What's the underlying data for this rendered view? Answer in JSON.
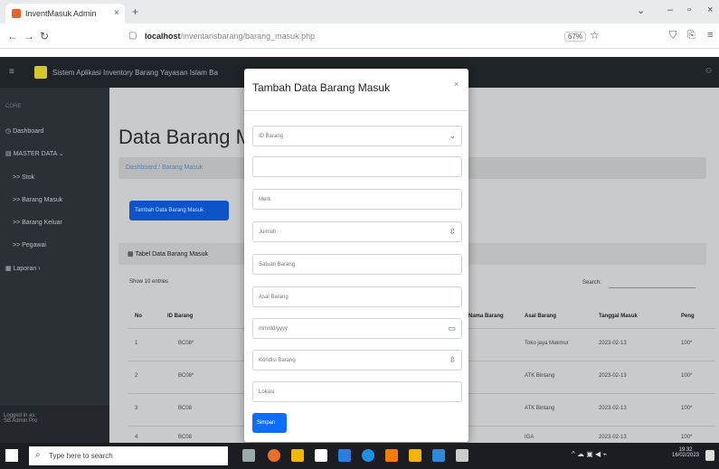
{
  "browser": {
    "tab_title": "InventMasuk Admin",
    "url_host": "localhost",
    "url_path": "/inventarisbarang/barang_masuk.php",
    "zoom": "67%"
  },
  "app": {
    "brand": "Sistem Aplikasi Inventory Barang Yayasan Islam Ba",
    "sidebar": {
      "core_heading": "CORE",
      "dashboard": "Dashboard",
      "master_heading": "MASTER DATA",
      "items": [
        ">> Stok",
        ">> Barang Masuk",
        ">> Barang Keluar",
        ">> Pegawai"
      ],
      "laporan": "Laporan",
      "footer_line1": "Logged in as:",
      "footer_line2": "SB Admin Pro"
    },
    "page_title": "Data Barang Ma",
    "breadcrumb": "Dashboard / Barang Masuk",
    "add_button": "Tambah Data Barang Masuk",
    "card_title": "Tabel Data Barang Masuk",
    "show_entries": "Show 10 entries",
    "search_label": "Search:",
    "table": {
      "headers": [
        "No",
        "ID Barang",
        "Nama Barang",
        "Asal Barang",
        "Tanggal Masuk",
        "Peng"
      ],
      "rows": [
        [
          "1",
          "BC08*",
          "Toko jaya Makmur",
          "2023-02-13",
          "100*"
        ],
        [
          "2",
          "BC08*",
          "ATK Bintang",
          "2023-02-13",
          "100*"
        ],
        [
          "3",
          "BC08",
          "ATK Bintang",
          "2023-02-13",
          "100*"
        ],
        [
          "4",
          "BC08",
          "IGA",
          "2023-02-13",
          "100*"
        ]
      ]
    }
  },
  "modal": {
    "title": "Tambah Data Barang Masuk",
    "close": "×",
    "fields": {
      "id_barang": "ID Barang",
      "blank": "",
      "merk": "Merk",
      "jumlah": "Jumlah",
      "satuan": "Satuan Barang",
      "asal": "Asal Barang",
      "tanggal": "mm/dd/yyyy",
      "kondisi": "Kondisi Barang",
      "lokasi": "Lokasi"
    },
    "save_button": "Simpan"
  },
  "taskbar": {
    "search_placeholder": "Type here to search",
    "time": "19:32",
    "date": "16/02/2023"
  }
}
